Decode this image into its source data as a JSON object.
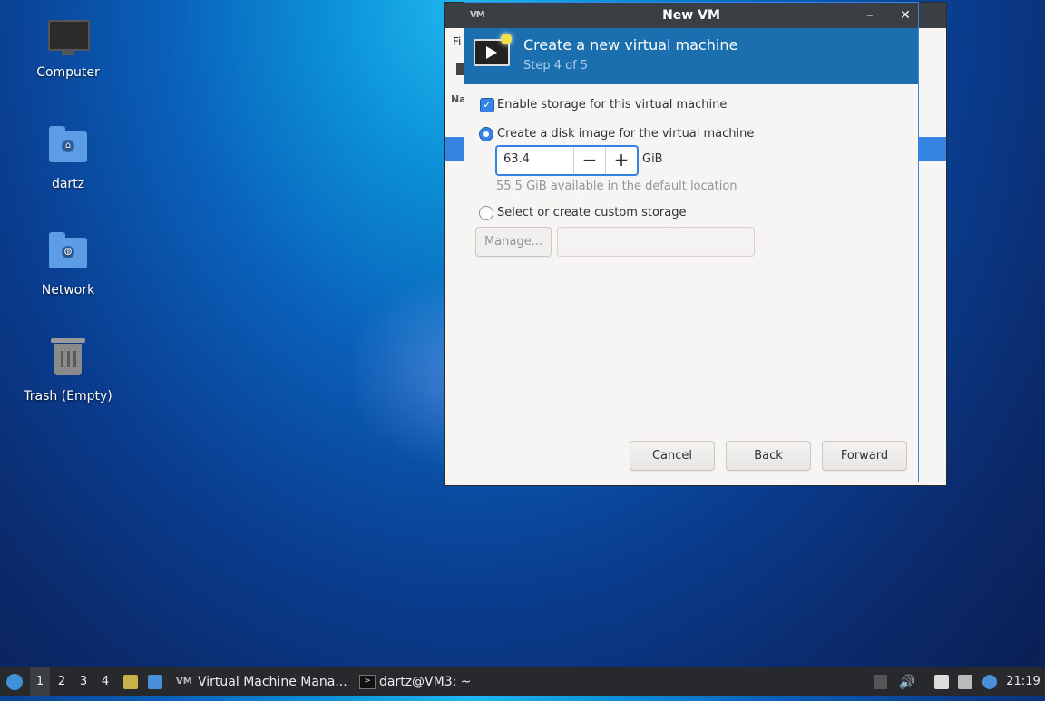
{
  "desktop": {
    "icons": [
      {
        "label": "Computer",
        "icon": "computer-icon"
      },
      {
        "label": "dartz",
        "icon": "home-folder-icon"
      },
      {
        "label": "Network",
        "icon": "network-folder-icon"
      },
      {
        "label": "Trash (Empty)",
        "icon": "trash-icon"
      }
    ]
  },
  "background_window": {
    "menu_partial": "Fi",
    "header_partial": "Na"
  },
  "dialog": {
    "title": "New VM",
    "minimize": "–",
    "close": "✕",
    "logo": "VM",
    "banner_title": "Create a new virtual machine",
    "banner_step": "Step 4 of 5",
    "enable_storage_label": "Enable storage for this virtual machine",
    "enable_storage_checked": true,
    "create_disk_label": "Create a disk image for the virtual machine",
    "disk_size_value": "63.4",
    "disk_unit": "GiB",
    "available_hint": "55.5 GiB available in the default location",
    "custom_storage_label": "Select or create custom storage",
    "manage_label": "Manage...",
    "custom_path_value": "",
    "selected_option": "create_disk",
    "buttons": {
      "cancel": "Cancel",
      "back": "Back",
      "forward": "Forward"
    }
  },
  "taskbar": {
    "workspaces": [
      "1",
      "2",
      "3",
      "4"
    ],
    "active_workspace": "1",
    "tasks": [
      {
        "label": "Virtual Machine Mana...",
        "icon": "vm-manager-icon"
      },
      {
        "label": "dartz@VM3: ~",
        "icon": "terminal-icon"
      }
    ],
    "clock": "21:19"
  },
  "colors": {
    "accent": "#3584e4",
    "banner": "#1b6fae",
    "titlebar": "#3a3f44",
    "taskbar": "#27292d"
  }
}
